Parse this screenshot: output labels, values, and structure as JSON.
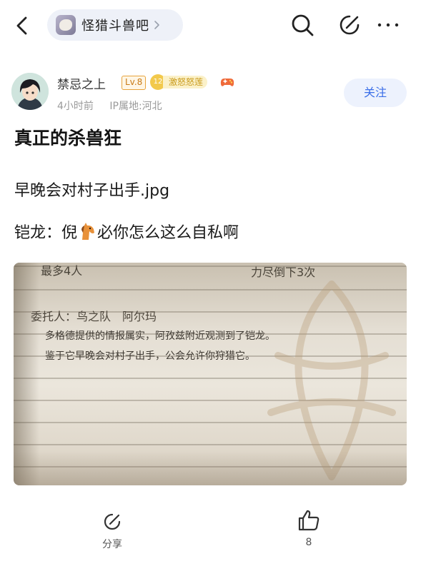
{
  "nav": {
    "forum_name": "怪猎斗兽吧",
    "icons": [
      "back-arrow-icon",
      "chevron-right-icon",
      "search-icon",
      "edit-icon",
      "more-icon"
    ]
  },
  "author": {
    "name": "禁忌之上",
    "level": "Lv.8",
    "title_level": "12",
    "title": "激怒怒莲",
    "time": "4小时前",
    "ip": "IP属地:河北",
    "follow_label": "关注"
  },
  "post": {
    "title": "真正的杀兽狂",
    "line1": "早晚会对村子出手.jpg",
    "line2_before": "铠龙：倪",
    "line2_after": "必你怎么这么自私啊"
  },
  "image_text": {
    "top_left": "最多4人",
    "top_right": "力尽倒下3次",
    "client": "委托人：鸟之队　阿尔玛",
    "body1": "多格德提供的情报属实，阿孜兹附近观测到了铠龙。",
    "body2": "鉴于它早晚会对村子出手，公会允许你狩猎它。"
  },
  "bottom": {
    "share_label": "分享",
    "like_count": "8"
  },
  "colors": {
    "accent": "#3a6ee8",
    "follow_bg": "#edf2fd",
    "pill_bg": "#eef1f8",
    "level_badge": "#e7a33c",
    "title_badge": "#f2c94c"
  }
}
